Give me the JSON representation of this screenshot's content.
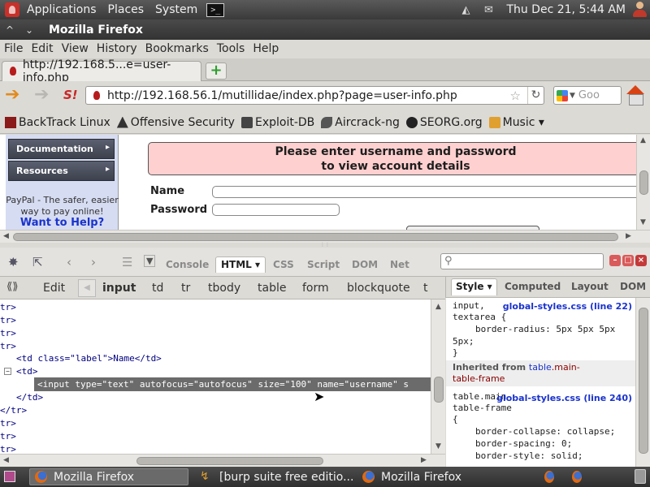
{
  "panel": {
    "menus": [
      "Applications",
      "Places",
      "System"
    ],
    "terminal_glyph": ">_",
    "clock": "Thu Dec 21,  5:44 AM"
  },
  "window": {
    "title": "Mozilla Firefox",
    "btn_min": "^",
    "btn_close": "⌄"
  },
  "menubar": [
    "File",
    "Edit",
    "View",
    "History",
    "Bookmarks",
    "Tools",
    "Help"
  ],
  "tab": {
    "label": "http://192.168.5...e=user-info.php",
    "new_tab": "+"
  },
  "nav": {
    "url": "http://192.168.56.1/mutillidae/index.php?page=user-info.php",
    "search_placeholder": "Goo"
  },
  "bookmarks": [
    {
      "label": "BackTrack Linux",
      "icon": "backtrack-icon"
    },
    {
      "label": "Offensive Security",
      "icon": "offsec-icon"
    },
    {
      "label": "Exploit-DB",
      "icon": "exploitdb-icon"
    },
    {
      "label": "Aircrack-ng",
      "icon": "aircrack-icon"
    },
    {
      "label": "SEORG.org",
      "icon": "seorg-icon"
    },
    {
      "label": "Music ▾",
      "icon": "folder-icon"
    }
  ],
  "page": {
    "sidebar": [
      "Documentation",
      "Resources"
    ],
    "paypal_line1": "PayPal - The safer, easier",
    "paypal_line2": "way to pay online!",
    "help": "Want to Help?",
    "prompt_line1": "Please enter username and password",
    "prompt_line2": "to view account details",
    "name_label": "Name",
    "password_label": "Password"
  },
  "firebug": {
    "tabs": [
      "Console",
      "HTML ▾",
      "CSS",
      "Script",
      "DOM",
      "Net"
    ],
    "active_tab": "HTML",
    "crumbs": [
      "Edit",
      "input",
      "td",
      "tr",
      "tbody",
      "table",
      "form",
      "blockquote",
      "t"
    ],
    "tree": [
      {
        "text": "tr>",
        "indent": 0
      },
      {
        "text": "tr>",
        "indent": 0
      },
      {
        "text": "tr>",
        "indent": 0
      },
      {
        "text": "tr>",
        "indent": 0
      },
      {
        "text": "<td class=\"label\">Name</td>",
        "indent": 1
      },
      {
        "text": "<td>",
        "indent": 1
      },
      {
        "text": "",
        "indent": 0
      },
      {
        "text": "</td>",
        "indent": 1
      },
      {
        "text": "</tr>",
        "indent": 0
      },
      {
        "text": "tr>",
        "indent": 0
      },
      {
        "text": "tr>",
        "indent": 0
      },
      {
        "text": "tr>",
        "indent": 0
      }
    ],
    "selected_node": "<input type=\"text\" autofocus=\"autofocus\" size=\"100\" name=\"username\" s",
    "style_tabs": [
      "Style ▾",
      "Computed",
      "Layout",
      "DOM"
    ],
    "styles": {
      "rule1_selector_a": "input,",
      "rule1_selector_b": "textarea {",
      "rule1_source": "global-styles.css (line 22)",
      "rule1_decl_a": "border-radius: 5px 5px 5px",
      "rule1_decl_b": "5px;",
      "rule1_close": "}",
      "inherited_label": "Inherited from",
      "inherited_ref": "table",
      "inherited_ref2": ".main-",
      "inherited_ref3": "table-frame",
      "rule2_selector_a": "table.main-",
      "rule2_selector_b": "table-frame",
      "rule2_open": "{",
      "rule2_source": "global-styles.css (line 240)",
      "rule2_decl_a": "border-collapse: collapse;",
      "rule2_decl_b": "border-spacing: 0;",
      "rule2_decl_c": "border-style: solid;"
    }
  },
  "taskbar": [
    {
      "label": "Mozilla Firefox",
      "active": true
    },
    {
      "label": "[burp suite free editio...",
      "active": false
    },
    {
      "label": "Mozilla Firefox",
      "active": false
    }
  ]
}
